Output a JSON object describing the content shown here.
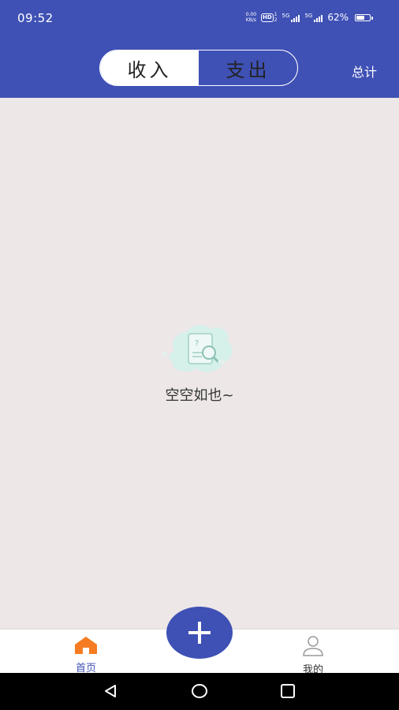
{
  "status_bar": {
    "time": "09:52",
    "net_speed_value": "0.00",
    "net_speed_unit": "KB/s",
    "hd_label": "HD",
    "sim1_label": "1",
    "sim2_label": "2",
    "signal1_label": "5G",
    "signal2_label": "5G",
    "battery_percent": "62%",
    "battery_level": 0.62
  },
  "header": {
    "tabs": [
      {
        "label": "收入",
        "active": true
      },
      {
        "label": "支出",
        "active": false
      }
    ],
    "total_label": "总计"
  },
  "empty_state": {
    "message": "空空如也~",
    "icon": "empty-document-search-icon"
  },
  "bottom_nav": {
    "items": [
      {
        "label": "首页",
        "icon": "home-icon",
        "active": true
      },
      {
        "label": "我的",
        "icon": "profile-icon",
        "active": false
      }
    ],
    "fab_icon": "plus-icon"
  },
  "system_nav": {
    "icons": [
      "back-icon",
      "home-circle-icon",
      "recents-icon"
    ]
  },
  "colors": {
    "primary": "#3f51b5",
    "background": "#ede7e7",
    "home_icon": "#f57c22",
    "illustration": "#d6f0ea"
  }
}
